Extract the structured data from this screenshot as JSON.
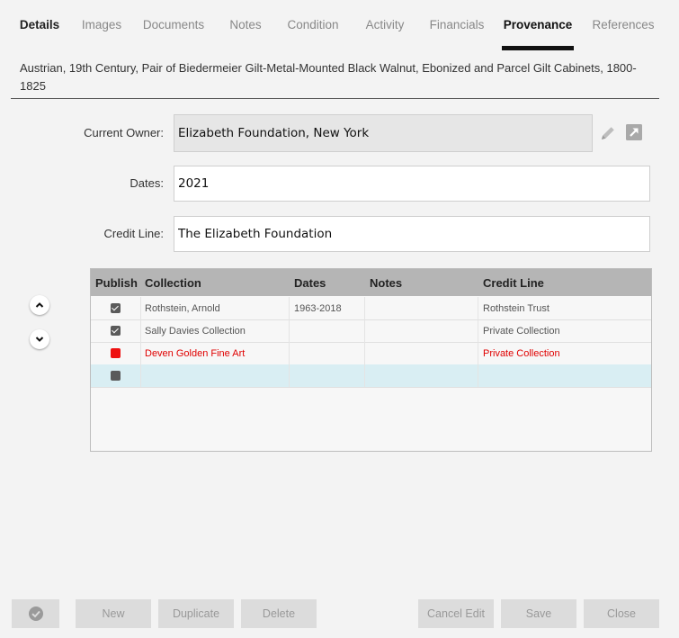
{
  "tabs": [
    {
      "label": "Details"
    },
    {
      "label": "Images"
    },
    {
      "label": "Documents"
    },
    {
      "label": "Notes"
    },
    {
      "label": "Condition"
    },
    {
      "label": "Activity"
    },
    {
      "label": "Financials"
    },
    {
      "label": "Provenance"
    },
    {
      "label": "References"
    }
  ],
  "selected_tab": "Provenance",
  "object_title": "Austrian, 19th Century, Pair of Biedermeier Gilt-Metal-Mounted Black Walnut, Ebonized and Parcel Gilt Cabinets, 1800-1825",
  "form": {
    "current_owner_label": "Current Owner:",
    "current_owner_value": "Elizabeth Foundation, New York",
    "dates_label": "Dates:",
    "dates_value": "2021",
    "credit_line_label": "Credit Line:",
    "credit_line_value": "The Elizabeth Foundation"
  },
  "icons": {
    "edit": "pencil-icon",
    "open": "open-external-icon",
    "move_up": "chevron-up-icon",
    "move_down": "chevron-down-icon",
    "confirm": "checkmark-circle-icon"
  },
  "grid": {
    "columns": [
      "Publish",
      "Collection",
      "Dates",
      "Notes",
      "Credit Line"
    ],
    "rows": [
      {
        "publish": "checked",
        "collection": "Rothstein, Arnold",
        "dates": "1963-2018",
        "notes": "",
        "credit_line": "Rothstein Trust",
        "flagged": false
      },
      {
        "publish": "checked",
        "collection": "Sally Davies Collection",
        "dates": "",
        "notes": "",
        "credit_line": "Private Collection",
        "flagged": false
      },
      {
        "publish": "unchecked",
        "collection": "Deven Golden Fine Art",
        "dates": "",
        "notes": "",
        "credit_line": "Private Collection",
        "flagged": true
      },
      {
        "publish": "unchecked",
        "collection": "",
        "dates": "",
        "notes": "",
        "credit_line": "",
        "flagged": false
      }
    ]
  },
  "colors": {
    "flag": "#e00000",
    "header": "#b5b5b5",
    "active_row": "#d9eef3"
  },
  "footer": {
    "new_label": "New",
    "duplicate_label": "Duplicate",
    "delete_label": "Delete",
    "cancel_edit_label": "Cancel Edit",
    "save_label": "Save",
    "close_label": "Close"
  }
}
